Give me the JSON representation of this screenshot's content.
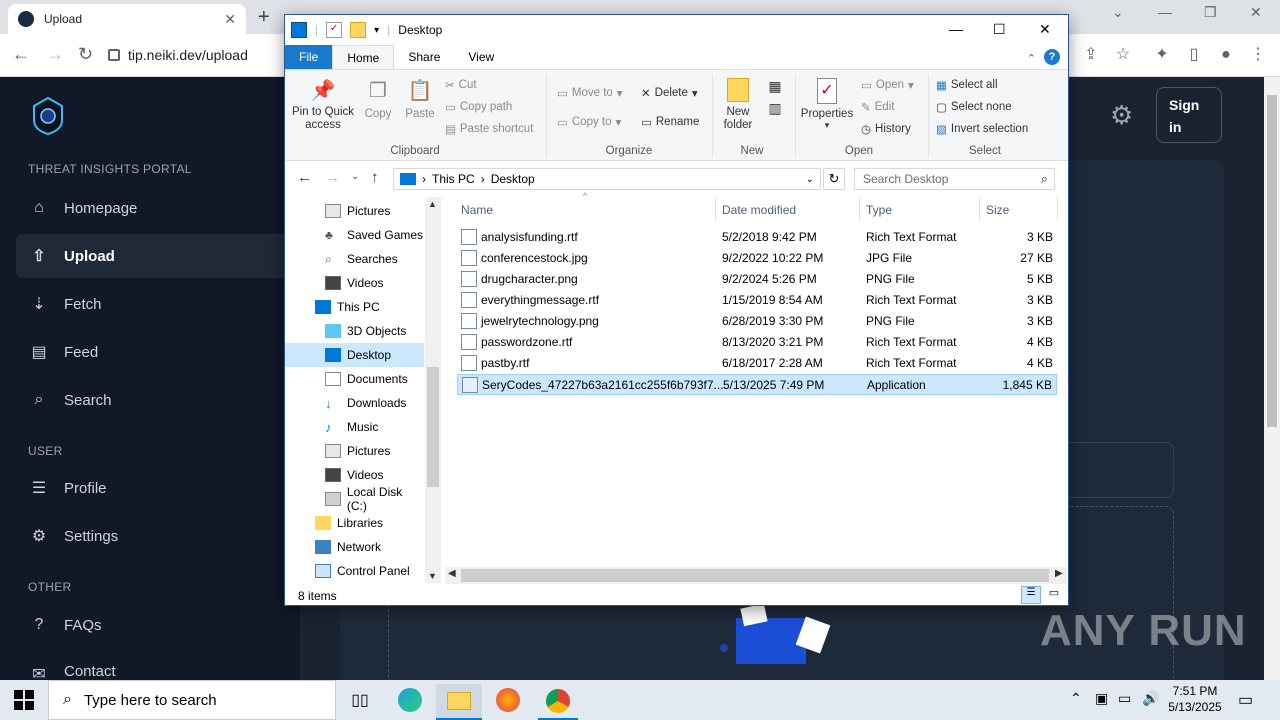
{
  "browser": {
    "tab_title": "Upload",
    "url": "tip.neiki.dev/upload"
  },
  "site": {
    "portal_label": "THREAT INSIGHTS PORTAL",
    "nav": [
      {
        "label": "Homepage",
        "icon": "home-icon"
      },
      {
        "label": "Upload",
        "icon": "upload-icon"
      },
      {
        "label": "Fetch",
        "icon": "download-icon"
      },
      {
        "label": "Feed",
        "icon": "feed-icon"
      },
      {
        "label": "Search",
        "icon": "search-icon"
      }
    ],
    "user_label": "USER",
    "user_nav": [
      {
        "label": "Profile",
        "icon": "profile-icon"
      },
      {
        "label": "Settings",
        "icon": "gear-icon"
      }
    ],
    "other_label": "OTHER",
    "other_nav": [
      {
        "label": "FAQs",
        "icon": "faq-icon"
      },
      {
        "label": "Contact",
        "icon": "contact-icon"
      }
    ],
    "sign_in": "Sign in"
  },
  "explorer": {
    "title": "Desktop",
    "tabs": {
      "file": "File",
      "home": "Home",
      "share": "Share",
      "view": "View"
    },
    "ribbon": {
      "pin": "Pin to Quick access",
      "copy": "Copy",
      "paste": "Paste",
      "cut": "Cut",
      "copy_path": "Copy path",
      "paste_shortcut": "Paste shortcut",
      "move_to": "Move to",
      "copy_to": "Copy to",
      "delete": "Delete",
      "rename": "Rename",
      "new_folder": "New folder",
      "properties": "Properties",
      "open": "Open",
      "edit": "Edit",
      "history": "History",
      "select_all": "Select all",
      "select_none": "Select none",
      "invert_selection": "Invert selection",
      "groups": {
        "clipboard": "Clipboard",
        "organize": "Organize",
        "new": "New",
        "open": "Open",
        "select": "Select"
      }
    },
    "address": {
      "root": "This PC",
      "current": "Desktop"
    },
    "search_placeholder": "Search Desktop",
    "nav_pane": [
      "Pictures",
      "Saved Games",
      "Searches",
      "Videos",
      "This PC",
      "3D Objects",
      "Desktop",
      "Documents",
      "Downloads",
      "Music",
      "Pictures",
      "Videos",
      "Local Disk (C:)",
      "Libraries",
      "Network",
      "Control Panel"
    ],
    "columns": {
      "name": "Name",
      "date": "Date modified",
      "type": "Type",
      "size": "Size"
    },
    "files": [
      {
        "name": "analysisfunding.rtf",
        "date": "5/2/2018 9:42 PM",
        "type": "Rich Text Format",
        "size": "3 KB"
      },
      {
        "name": "conferencestock.jpg",
        "date": "9/2/2022 10:22 PM",
        "type": "JPG File",
        "size": "27 KB"
      },
      {
        "name": "drugcharacter.png",
        "date": "9/2/2024 5:26 PM",
        "type": "PNG File",
        "size": "5 KB"
      },
      {
        "name": "everythingmessage.rtf",
        "date": "1/15/2019 8:54 AM",
        "type": "Rich Text Format",
        "size": "3 KB"
      },
      {
        "name": "jewelrytechnology.png",
        "date": "6/28/2019 3:30 PM",
        "type": "PNG File",
        "size": "3 KB"
      },
      {
        "name": "passwordzone.rtf",
        "date": "8/13/2020 3:21 PM",
        "type": "Rich Text Format",
        "size": "4 KB"
      },
      {
        "name": "pastby.rtf",
        "date": "6/18/2017 2:28 AM",
        "type": "Rich Text Format",
        "size": "4 KB"
      },
      {
        "name": "SeryCodes_47227b63a2161cc255f6b793f7...",
        "date": "5/13/2025 7:49 PM",
        "type": "Application",
        "size": "1,845 KB"
      }
    ],
    "status": "8 items"
  },
  "taskbar": {
    "search_placeholder": "Type here to search",
    "time": "7:51 PM",
    "date": "5/13/2025"
  },
  "watermark": "ANY RUN"
}
